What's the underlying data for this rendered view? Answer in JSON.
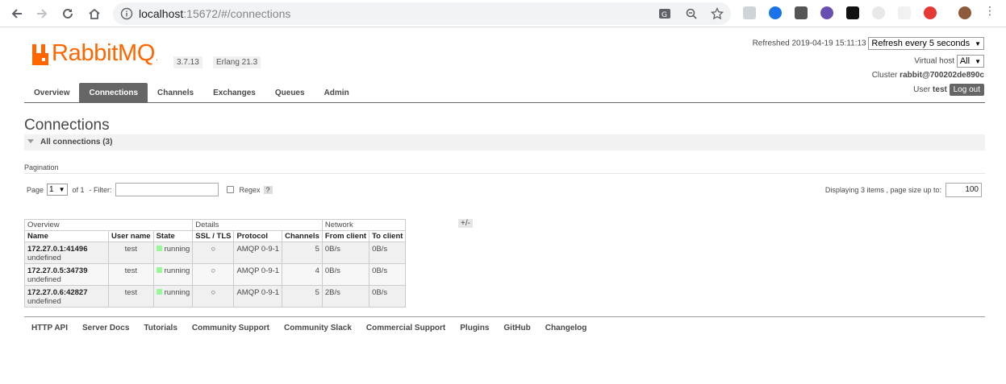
{
  "browser": {
    "url_host": "localhost",
    "url_rest": ":15672/#/connections"
  },
  "brand": {
    "logo_rabbit": "Rabbit",
    "logo_mq": "MQ",
    "logo_dot": ".",
    "version": "3.7.13",
    "erlang": "Erlang 21.3",
    "accent": "#ff6600"
  },
  "header": {
    "refreshed_label": "Refreshed",
    "refreshed_time": "2019-04-19 15:11:13",
    "refresh_option": "Refresh every 5 seconds",
    "vhost_label": "Virtual host",
    "vhost_value": "All",
    "cluster_label": "Cluster",
    "cluster_value": "rabbit@700202de890c",
    "user_label": "User",
    "user_value": "test",
    "logout_label": "Log out"
  },
  "tabs": [
    "Overview",
    "Connections",
    "Channels",
    "Exchanges",
    "Queues",
    "Admin"
  ],
  "page": {
    "title": "Connections",
    "section_title": "All connections (3)"
  },
  "pagination": {
    "label": "Pagination",
    "page_label": "Page",
    "page_value": "1",
    "of_label": "of 1",
    "filter_label": "- Filter:",
    "filter_value": "",
    "regex_label": "Regex",
    "help_label": "?",
    "displaying_text": "Displaying 3 items , page size up to:",
    "page_size": "100"
  },
  "table": {
    "groups": [
      "Overview",
      "Details",
      "Network"
    ],
    "columns": [
      "Name",
      "User name",
      "State",
      "SSL / TLS",
      "Protocol",
      "Channels",
      "From client",
      "To client"
    ],
    "plus_minus": "+/-",
    "rows": [
      {
        "name": "172.27.0.1:41496",
        "sub": "undefined",
        "user": "test",
        "state": "running",
        "ssl": "○",
        "protocol": "AMQP 0-9-1",
        "channels": "5",
        "from_client": "0B/s",
        "to_client": "0B/s"
      },
      {
        "name": "172.27.0.5:34739",
        "sub": "undefined",
        "user": "test",
        "state": "running",
        "ssl": "○",
        "protocol": "AMQP 0-9-1",
        "channels": "4",
        "from_client": "0B/s",
        "to_client": "0B/s"
      },
      {
        "name": "172.27.0.6:42827",
        "sub": "undefined",
        "user": "test",
        "state": "running",
        "ssl": "○",
        "protocol": "AMQP 0-9-1",
        "channels": "5",
        "from_client": "2B/s",
        "to_client": "0B/s"
      }
    ]
  },
  "footer": [
    "HTTP API",
    "Server Docs",
    "Tutorials",
    "Community Support",
    "Community Slack",
    "Commercial Support",
    "Plugins",
    "GitHub",
    "Changelog"
  ]
}
